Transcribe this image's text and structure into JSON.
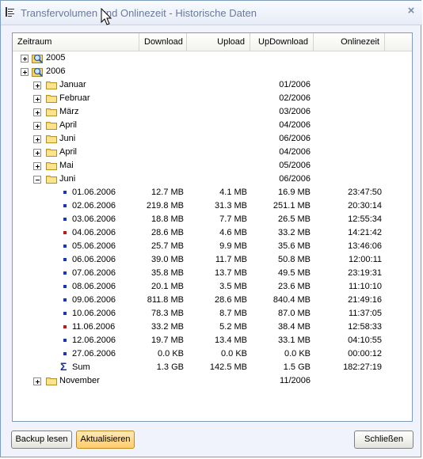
{
  "window": {
    "title": "Transfervolumen und Onlinezeit - Historische Daten",
    "close_glyph": "×"
  },
  "columns": {
    "zeitraum": "Zeitraum",
    "download": "Download",
    "upload": "Upload",
    "updownload": "UpDownload",
    "onlinezeit": "Onlinezeit"
  },
  "tree": {
    "year2005": {
      "label": "2005"
    },
    "year2006": {
      "label": "2006"
    },
    "months": [
      {
        "label": "Januar",
        "period": "01/2006"
      },
      {
        "label": "Februar",
        "period": "02/2006"
      },
      {
        "label": "März",
        "period": "03/2006"
      },
      {
        "label": "April",
        "period": "04/2006"
      },
      {
        "label": "Juni",
        "period": "06/2006"
      },
      {
        "label": "April",
        "period": "04/2006"
      },
      {
        "label": "Mai",
        "period": "05/2006"
      },
      {
        "label": "Juni",
        "period": "06/2006"
      }
    ],
    "days": [
      {
        "date": "01.06.2006",
        "download": "12.7 MB",
        "upload": "4.1 MB",
        "updownload": "16.9 MB",
        "online": "23:47:50",
        "color": "#1a35b8"
      },
      {
        "date": "02.06.2006",
        "download": "219.8 MB",
        "upload": "31.3 MB",
        "updownload": "251.1 MB",
        "online": "20:30:14",
        "color": "#1a35b8"
      },
      {
        "date": "03.06.2006",
        "download": "18.8 MB",
        "upload": "7.7 MB",
        "updownload": "26.5 MB",
        "online": "12:55:34",
        "color": "#1a35b8"
      },
      {
        "date": "04.06.2006",
        "download": "28.6 MB",
        "upload": "4.6 MB",
        "updownload": "33.2 MB",
        "online": "14:21:42",
        "color": "#c01818"
      },
      {
        "date": "05.06.2006",
        "download": "25.7 MB",
        "upload": "9.9 MB",
        "updownload": "35.6 MB",
        "online": "13:46:06",
        "color": "#1a35b8"
      },
      {
        "date": "06.06.2006",
        "download": "39.0 MB",
        "upload": "11.7 MB",
        "updownload": "50.8 MB",
        "online": "12:00:11",
        "color": "#1a35b8"
      },
      {
        "date": "07.06.2006",
        "download": "35.8 MB",
        "upload": "13.7 MB",
        "updownload": "49.5 MB",
        "online": "23:19:31",
        "color": "#1a35b8"
      },
      {
        "date": "08.06.2006",
        "download": "20.1 MB",
        "upload": "3.5 MB",
        "updownload": "23.6 MB",
        "online": "11:10:10",
        "color": "#1a35b8"
      },
      {
        "date": "09.06.2006",
        "download": "811.8 MB",
        "upload": "28.6 MB",
        "updownload": "840.4 MB",
        "online": "21:49:16",
        "color": "#1a35b8"
      },
      {
        "date": "10.06.2006",
        "download": "78.3 MB",
        "upload": "8.7 MB",
        "updownload": "87.0 MB",
        "online": "11:37:05",
        "color": "#1a35b8"
      },
      {
        "date": "11.06.2006",
        "download": "33.2 MB",
        "upload": "5.2 MB",
        "updownload": "38.4 MB",
        "online": "12:58:33",
        "color": "#c01818"
      },
      {
        "date": "12.06.2006",
        "download": "19.7 MB",
        "upload": "13.4 MB",
        "updownload": "33.1 MB",
        "online": "04:10:55",
        "color": "#1a35b8"
      },
      {
        "date": "27.06.2006",
        "download": "0.0 KB",
        "upload": "0.0 KB",
        "updownload": "0.0 KB",
        "online": "00:00:12",
        "color": "#1a35b8"
      }
    ],
    "sum": {
      "label": "Sum",
      "download": "1.3 GB",
      "upload": "142.5 MB",
      "updownload": "1.5 GB",
      "online": "182:27:19"
    },
    "november": {
      "label": "November",
      "period": "11/2006"
    }
  },
  "buttons": {
    "backup": "Backup lesen",
    "refresh": "Aktualisieren",
    "close": "Schließen"
  },
  "icons": {
    "app": "chart-list-icon",
    "year": "magnifier-folder-icon",
    "month": "folder-icon",
    "day": "bullet-icon",
    "sum": "sigma-icon"
  }
}
